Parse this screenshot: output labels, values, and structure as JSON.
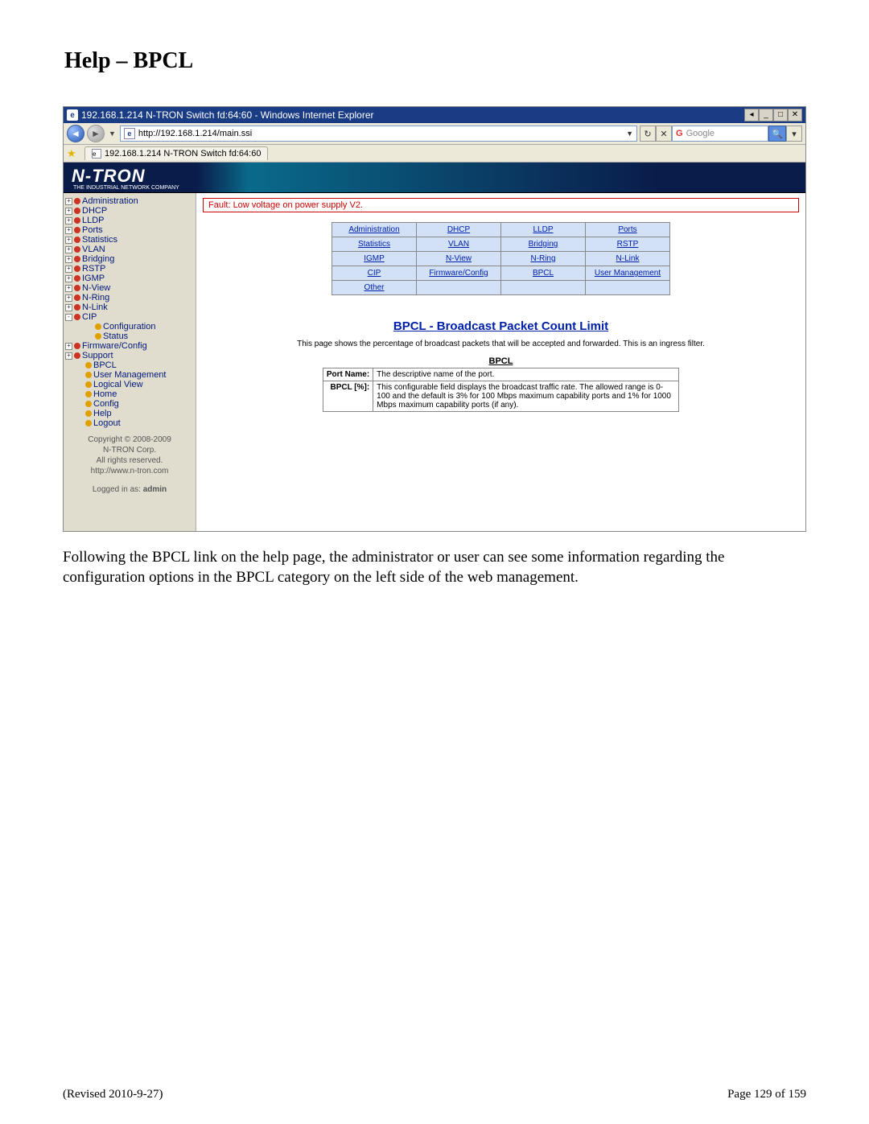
{
  "page_title": "Help – BPCL",
  "browser": {
    "window_title": "192.168.1.214 N-TRON Switch fd:64:60 - Windows Internet Explorer",
    "url": "http://192.168.1.214/main.ssi",
    "search_provider": "Google",
    "tab_title": "192.168.1.214 N-TRON Switch fd:64:60"
  },
  "brand": {
    "name": "N-TRON",
    "subtitle": "THE INDUSTRIAL NETWORK COMPANY"
  },
  "sidebar": {
    "items": [
      {
        "label": "Administration",
        "box": "+",
        "ball": "red"
      },
      {
        "label": "DHCP",
        "box": "+",
        "ball": "red"
      },
      {
        "label": "LLDP",
        "box": "+",
        "ball": "red"
      },
      {
        "label": "Ports",
        "box": "+",
        "ball": "red"
      },
      {
        "label": "Statistics",
        "box": "+",
        "ball": "red"
      },
      {
        "label": "VLAN",
        "box": "+",
        "ball": "red"
      },
      {
        "label": "Bridging",
        "box": "+",
        "ball": "red"
      },
      {
        "label": "RSTP",
        "box": "+",
        "ball": "red"
      },
      {
        "label": "IGMP",
        "box": "+",
        "ball": "red"
      },
      {
        "label": "N-View",
        "box": "+",
        "ball": "red"
      },
      {
        "label": "N-Ring",
        "box": "+",
        "ball": "red"
      },
      {
        "label": "N-Link",
        "box": "+",
        "ball": "red"
      },
      {
        "label": "CIP",
        "box": "-",
        "ball": "red"
      }
    ],
    "cip_children": [
      {
        "label": "Configuration",
        "ball": "yellow"
      },
      {
        "label": "Status",
        "ball": "yellow"
      }
    ],
    "items2": [
      {
        "label": "Firmware/Config",
        "box": "+",
        "ball": "red"
      },
      {
        "label": "Support",
        "box": "+",
        "ball": "red"
      }
    ],
    "leaf_items": [
      {
        "label": "BPCL",
        "ball": "yellow"
      },
      {
        "label": "User Management",
        "ball": "yellow"
      },
      {
        "label": "Logical View",
        "ball": "yellow"
      },
      {
        "label": "Home",
        "ball": "yellow"
      },
      {
        "label": "Config",
        "ball": "yellow"
      },
      {
        "label": "Help",
        "ball": "yellow"
      },
      {
        "label": "Logout",
        "ball": "yellow"
      }
    ],
    "footer_lines": [
      "Copyright © 2008-2009",
      "N-TRON Corp.",
      "All rights reserved.",
      "http://www.n-tron.com"
    ],
    "logged_in_label": "Logged in as: ",
    "logged_in_user": "admin"
  },
  "main": {
    "fault_text": "Fault:  Low voltage on power supply V2.",
    "grid": [
      [
        "Administration",
        "DHCP",
        "LLDP",
        "Ports"
      ],
      [
        "Statistics",
        "VLAN",
        "Bridging",
        "RSTP"
      ],
      [
        "IGMP",
        "N-View",
        "N-Ring",
        "N-Link"
      ],
      [
        "CIP",
        "Firmware/Config",
        "BPCL",
        "User Management"
      ],
      [
        "Other",
        "",
        "",
        ""
      ]
    ],
    "section_title": "BPCL - Broadcast Packet Count Limit",
    "intro": "This page shows the percentage of broadcast packets that will be accepted and forwarded. This is an ingress filter.",
    "def_heading": "BPCL",
    "defs": [
      {
        "label": "Port Name:",
        "value": "The descriptive name of the port."
      },
      {
        "label": "BPCL [%]:",
        "value": "This configurable field displays the broadcast traffic rate. The allowed range is 0-100 and the default is 3% for 100 Mbps maximum capability ports and 1% for 1000 Mbps maximum capability ports (if any)."
      }
    ]
  },
  "body_paragraph": "Following the BPCL link on the help page, the administrator or user can see some information regarding the configuration options in the BPCL category on the left side of the web management.",
  "footer": {
    "revised": "(Revised 2010-9-27)",
    "page": "Page 129 of 159"
  }
}
